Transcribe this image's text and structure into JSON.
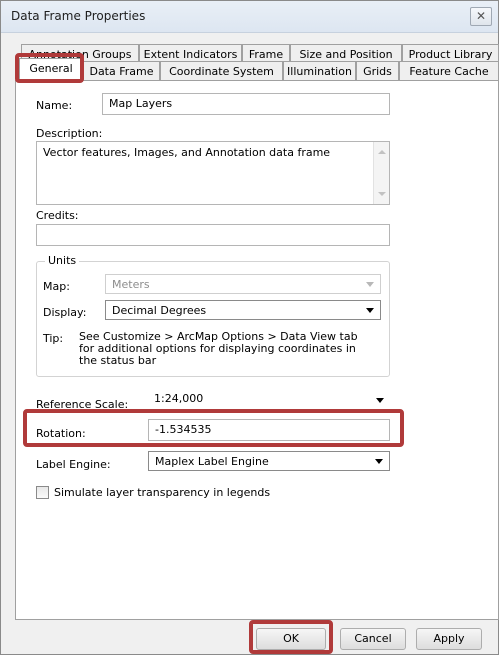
{
  "window": {
    "title": "Data Frame Properties",
    "close_glyph": "✕"
  },
  "tabs": {
    "row_back": [
      "Annotation Groups",
      "Extent Indicators",
      "Frame",
      "Size and Position",
      "Product Library"
    ],
    "row_front": [
      "General",
      "Data Frame",
      "Coordinate System",
      "Illumination",
      "Grids",
      "Feature Cache"
    ],
    "active": "General"
  },
  "general": {
    "name_label": "Name:",
    "name_value": "Map Layers",
    "description_label": "Description:",
    "description_value": "Vector features, Images, and Annotation data frame",
    "credits_label": "Credits:",
    "credits_value": "",
    "units": {
      "group_title": "Units",
      "map_label": "Map:",
      "map_value": "Meters",
      "display_label": "Display:",
      "display_value": "Decimal Degrees",
      "tip_label": "Tip:",
      "tip_text": "See Customize > ArcMap Options > Data View tab for additional options for displaying coordinates in the status bar"
    },
    "reference_scale_label": "Reference Scale:",
    "reference_scale_value": "1:24,000",
    "rotation_label": "Rotation:",
    "rotation_value": "-1.534535",
    "label_engine_label": "Label Engine:",
    "label_engine_value": "Maplex Label Engine",
    "simulate_transparency_label": "Simulate layer transparency in legends",
    "simulate_transparency_checked": false
  },
  "buttons": {
    "ok": "OK",
    "cancel": "Cancel",
    "apply": "Apply"
  },
  "highlight_color": "#b03a3a"
}
